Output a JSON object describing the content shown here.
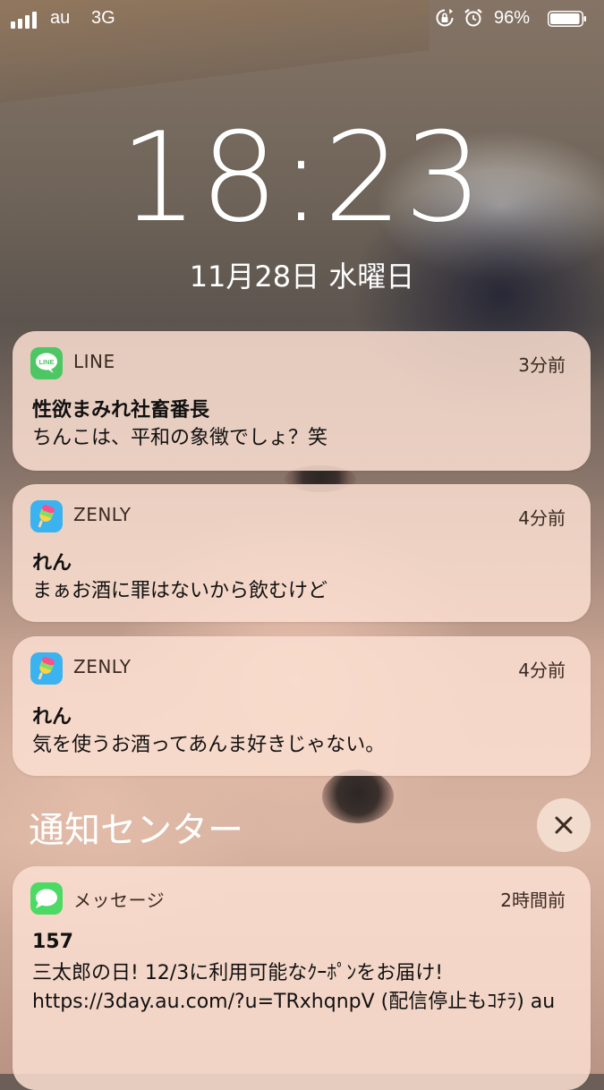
{
  "status_bar": {
    "carrier": "au",
    "network": "3G",
    "battery_percent": "96%",
    "signal_bars": 4,
    "battery_level": 0.96
  },
  "lock_screen": {
    "time": "18:23",
    "date": "11月28日 水曜日"
  },
  "notifications": [
    {
      "app": "LINE",
      "time": "3分前",
      "sender": "性欲まみれ社畜番長",
      "message": "ちんこは、平和の象徴でしょ？笑",
      "icon": "line-app-icon",
      "icon_color": "#4cc764"
    },
    {
      "app": "ZENLY",
      "time": "4分前",
      "sender": "れん",
      "message": "まぁお酒に罪はないから飲むけど",
      "icon": "zenly-app-icon",
      "icon_color": "#3ab3f0"
    },
    {
      "app": "ZENLY",
      "time": "4分前",
      "sender": "れん",
      "message": "気を使うお酒ってあんま好きじゃない。",
      "icon": "zenly-app-icon",
      "icon_color": "#3ab3f0"
    }
  ],
  "notification_center": {
    "title": "通知センター",
    "close_icon": "close-icon"
  },
  "center_notifications": [
    {
      "app": "メッセージ",
      "time": "2時間前",
      "sender": "157",
      "message": "三太郎の日! 12/3に利用可能なｸｰﾎﾟﾝをお届け! https://3day.au.com/?u=TRxhqnpV (配信停止もｺﾁﾗ) au",
      "icon": "messages-app-icon",
      "icon_color": "#4cd964"
    }
  ]
}
